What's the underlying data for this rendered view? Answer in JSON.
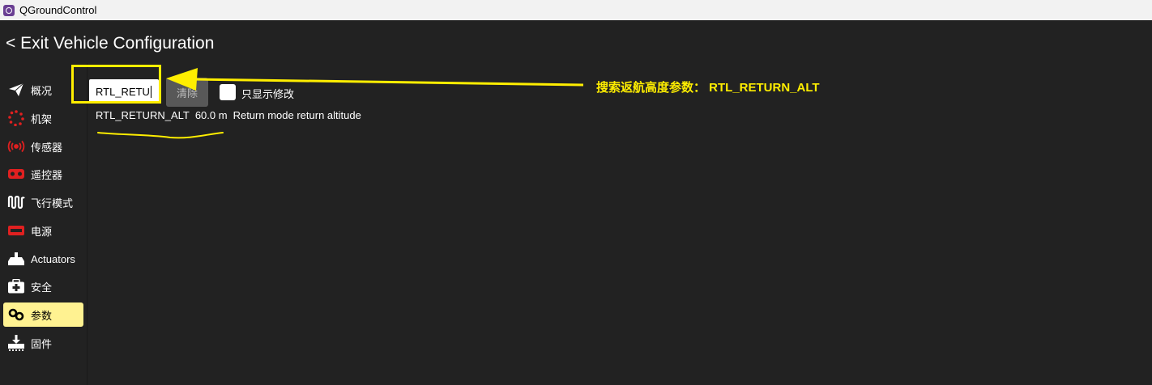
{
  "window": {
    "title": "QGroundControl"
  },
  "header": {
    "label": "< Exit Vehicle Configuration"
  },
  "sidebar": {
    "items": [
      {
        "label": "概况",
        "icon": "paper-plane-icon"
      },
      {
        "label": "机架",
        "icon": "airframe-dots-icon"
      },
      {
        "label": "传感器",
        "icon": "radio-waves-icon"
      },
      {
        "label": "遥控器",
        "icon": "gamepad-icon"
      },
      {
        "label": "飞行模式",
        "icon": "waveform-icon"
      },
      {
        "label": "电源",
        "icon": "battery-icon"
      },
      {
        "label": "Actuators",
        "icon": "actuator-icon"
      },
      {
        "label": "安全",
        "icon": "first-aid-icon"
      },
      {
        "label": "参数",
        "icon": "gears-icon"
      },
      {
        "label": "固件",
        "icon": "firmware-icon"
      }
    ],
    "active_index": 8
  },
  "search": {
    "value": "RTL_RETU"
  },
  "clear_button": {
    "label": "清除"
  },
  "show_modified": {
    "label": "只显示修改",
    "checked": false
  },
  "param": {
    "name": "RTL_RETURN_ALT",
    "value": "60.0 m",
    "description": "Return mode return altitude"
  },
  "annotation": {
    "text": "搜索返航高度参数： RTL_RETURN_ALT",
    "color": "#ffee00"
  },
  "colors": {
    "background": "#222222",
    "active_item": "#fff291",
    "alert_red": "#e02020"
  }
}
